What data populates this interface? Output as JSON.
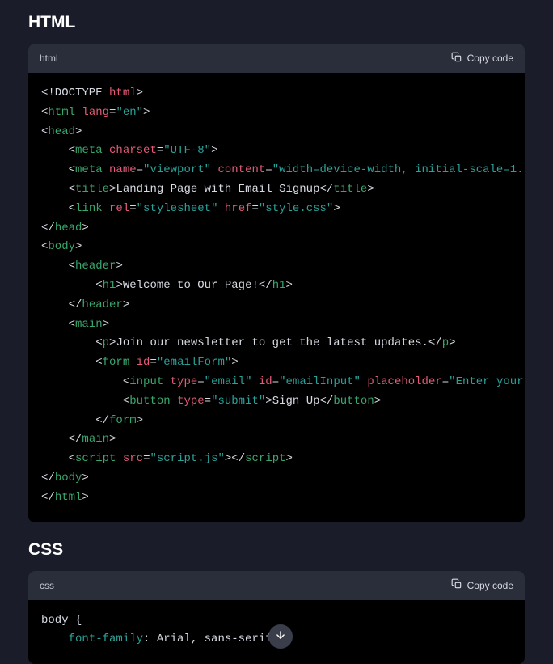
{
  "sections": {
    "html": {
      "heading": "HTML",
      "lang_label": "html",
      "copy_label": "Copy code"
    },
    "css": {
      "heading": "CSS",
      "lang_label": "css",
      "copy_label": "Copy code"
    }
  },
  "html_code": {
    "doctype": "<!DOCTYPE ",
    "doctype_kw": "html",
    "html_tag": "html",
    "lang_attr": "lang",
    "lang_val": "\"en\"",
    "head_tag": "head",
    "meta_tag": "meta",
    "charset_attr": "charset",
    "charset_val": "\"UTF-8\"",
    "name_attr": "name",
    "viewport_val": "\"viewport\"",
    "content_attr": "content",
    "content_val": "\"width=device-width, initial-scale=1.",
    "title_tag": "title",
    "title_text": "Landing Page with Email Signup",
    "link_tag": "link",
    "rel_attr": "rel",
    "rel_val": "\"stylesheet\"",
    "href_attr": "href",
    "href_val": "\"style.css\"",
    "body_tag": "body",
    "header_tag": "header",
    "h1_tag": "h1",
    "h1_text": "Welcome to Our Page!",
    "main_tag": "main",
    "p_tag": "p",
    "p_text": "Join our newsletter to get the latest updates.",
    "form_tag": "form",
    "id_attr": "id",
    "form_id_val": "\"emailForm\"",
    "input_tag": "input",
    "type_attr": "type",
    "email_val": "\"email\"",
    "input_id_val": "\"emailInput\"",
    "placeholder_attr": "placeholder",
    "placeholder_val": "\"Enter your",
    "button_tag": "button",
    "submit_val": "\"submit\"",
    "button_text": "Sign Up",
    "script_tag": "script",
    "src_attr": "src",
    "script_val": "\"script.js\""
  },
  "css_code": {
    "selector": "body",
    "brace_open": " {",
    "prop": "font-family",
    "value": ": Arial, sans-serif;"
  }
}
